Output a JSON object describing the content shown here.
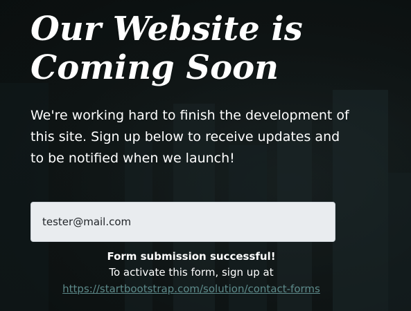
{
  "hero": {
    "title_line1": "Our Website is",
    "title_line2": "Coming Soon",
    "lead": "We're working hard to finish the development of this site. Sign up below to receive updates and to be notified when we launch!"
  },
  "form": {
    "email_value": "tester@mail.com",
    "success_title": "Form submission successful!",
    "activate_note": "To activate this form, sign up at",
    "link_text": "https://startbootstrap.com/solution/contact-forms"
  },
  "colors": {
    "background": "#0f1515",
    "text": "#ffffff",
    "input_bg": "#e9ecef",
    "link": "#5d8a8a"
  }
}
